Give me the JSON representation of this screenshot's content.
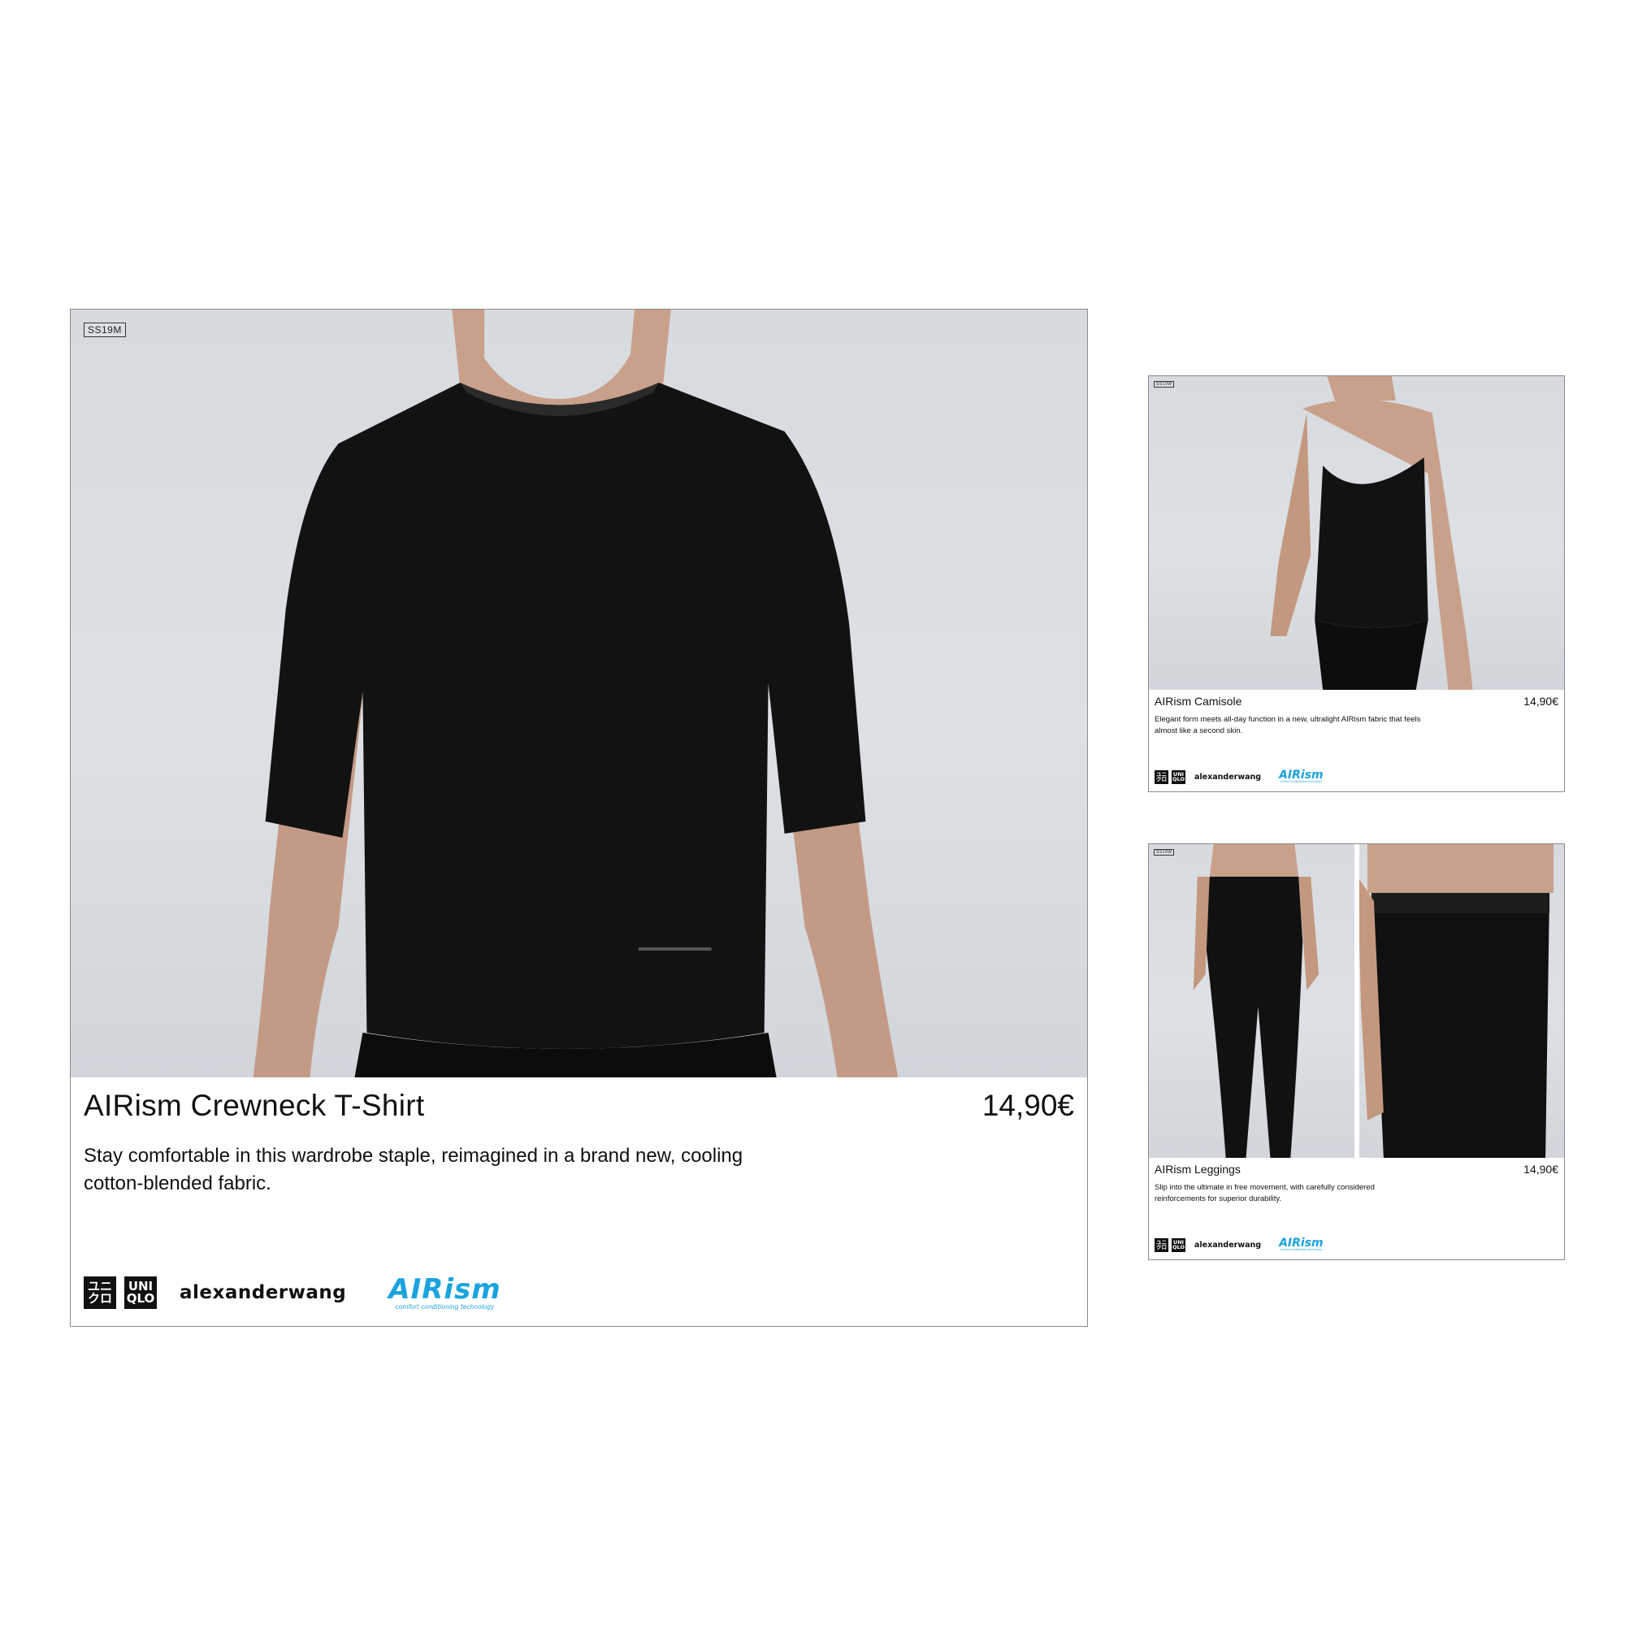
{
  "colors": {
    "background": "#ffffff",
    "card_border": "#8a8a8a",
    "photo_backdrop": "#d9dde1",
    "garment": "#111111",
    "skin": "#c9a08a",
    "airism_blue": "#1aa3df",
    "brand_black": "#111111"
  },
  "brand": {
    "uniqlo_katakana": [
      "ユニ",
      "クロ"
    ],
    "uniqlo_latin": [
      "UNI",
      "QLO"
    ],
    "alexanderwang": "alexanderwang",
    "airism": "AIRism",
    "airism_tagline": "comfort conditioning technology"
  },
  "cards": {
    "main": {
      "season": "SS19M",
      "title": "AIRism Crewneck T-Shirt",
      "price": "14,90€",
      "description": "Stay comfortable in this wardrobe staple, reimagined in a brand new, cooling cotton-blended fabric.",
      "photo": "model-tshirt-photo"
    },
    "camisole": {
      "season": "SS19W",
      "title": "AIRism Camisole",
      "price": "14,90€",
      "description": "Elegant form meets all-day function in a new, ultralight AIRism fabric that feels almost like a second skin.",
      "photo": "model-camisole-photo"
    },
    "leggings": {
      "season": "SS19W",
      "title": "AIRism Leggings",
      "price": "14,90€",
      "description": "Slip into the ultimate in free movement, with carefully considered reinforcements for superior durability.",
      "photo": "model-leggings-photo"
    }
  }
}
